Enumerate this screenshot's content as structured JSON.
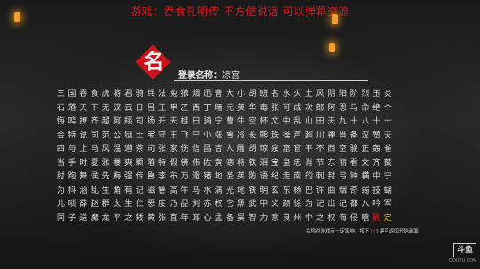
{
  "stream_banner": "游戏：吞食孔明传   不方便说话 可以弹幕交流",
  "seal_char": "名",
  "name_entry": {
    "label": "登录名称：",
    "value": "凉宫"
  },
  "char_grid": [
    [
      "三",
      "国",
      "吞",
      "食",
      "虎",
      "将",
      "君",
      "骑",
      "兵",
      "法",
      "兔",
      "狼",
      "烟",
      "迅",
      "曹",
      "大",
      "小",
      "胡",
      "班",
      "名",
      "水",
      "火",
      "土",
      "风",
      "阴",
      "阳",
      "阶",
      "烈",
      "玉",
      "炎"
    ],
    [
      "石",
      "落",
      "天",
      "下",
      "无",
      "双",
      "云",
      "日",
      "吕",
      "王",
      "甲",
      "乙",
      "西",
      "丁",
      "暗",
      "元",
      "美",
      "华",
      "毒",
      "张",
      "可",
      "成",
      "次",
      "郎",
      "阿",
      "恩",
      "马",
      "命",
      "绝",
      "个"
    ],
    [
      "悔",
      "鸣",
      "撩",
      "齐",
      "超",
      "阿",
      "翔",
      "司",
      "扬",
      "开",
      "天",
      "桂",
      "田",
      "骑",
      "宁",
      "曹",
      "牛",
      "空",
      "杯",
      "文",
      "中",
      "乱",
      "山",
      "田",
      "天",
      "九",
      "十",
      "八",
      "十",
      "十"
    ],
    [
      "会",
      "特",
      "说",
      "司",
      "范",
      "公",
      "狱",
      "士",
      "宝",
      "守",
      "王",
      "飞",
      "宁",
      "小",
      "张",
      "鲁",
      "冷",
      "长",
      "熊",
      "珠",
      "操",
      "芦",
      "超",
      "川",
      "神",
      "肖",
      "备",
      "汉",
      "赞",
      "天"
    ],
    [
      "四",
      "与",
      "上",
      "马",
      "凤",
      "温",
      "道",
      "茶",
      "司",
      "张",
      "家",
      "伤",
      "信",
      "昌",
      "吉",
      "人",
      "雕",
      "胡",
      "琼",
      "泉",
      "窟",
      "官",
      "平",
      "不",
      "西",
      "空",
      "骏",
      "正",
      "轰",
      "雀"
    ],
    [
      "当",
      "手",
      "时",
      "夏",
      "雅",
      "楼",
      "爽",
      "颗",
      "落",
      "特",
      "假",
      "佛",
      "伟",
      "佐",
      "黄",
      "德",
      "将",
      "铁",
      "泪",
      "宝",
      "皇",
      "忠",
      "肖",
      "节",
      "东",
      "丽",
      "看",
      "文",
      "齐",
      "鼓"
    ],
    [
      "肘",
      "跑",
      "舞",
      "侯",
      "先",
      "梅",
      "强",
      "传",
      "鲁",
      "李",
      "布",
      "万",
      "遗",
      "猪",
      "地",
      "圣",
      "英",
      "防",
      "语",
      "纪",
      "走",
      "南",
      "的",
      "刺",
      "封",
      "弓",
      "钟",
      "横",
      "中",
      "宁"
    ],
    [
      "为",
      "抖",
      "涵",
      "乱",
      "生",
      "角",
      "有",
      "记",
      "磁",
      "鲁",
      "高",
      "牛",
      "马",
      "水",
      "满",
      "光",
      "地",
      "铁",
      "明",
      "玄",
      "东",
      "杨",
      "巴",
      "许",
      "曲",
      "烟",
      "奇",
      "弱",
      "技",
      "蝴"
    ],
    [
      "儿",
      "唢",
      "薛",
      "赵",
      "群",
      "太",
      "生",
      "仁",
      "恶",
      "度",
      "乃",
      "品",
      "刘",
      "赤",
      "权",
      "它",
      "黑",
      "武",
      "甲",
      "义",
      "颜",
      "徐",
      "为",
      "记",
      "出",
      "记",
      "都",
      "入",
      "吟",
      "军"
    ],
    [
      "同",
      "子",
      "送",
      "魔",
      "龙",
      "平",
      "之",
      "矮",
      "黄",
      "张",
      "直",
      "年",
      "耳",
      "心",
      "孟",
      "备",
      "吴",
      "智",
      "力",
      "意",
      "良",
      "州",
      "中",
      "之",
      "权",
      "海",
      "侵",
      "嘻",
      "删",
      "定"
    ]
  ],
  "hint": {
    "before": "名称对游戏有一定影响。按下",
    "key": "Y",
    "after": "键可返回开始画面"
  },
  "watermark": {
    "logo": "斗鱼",
    "site": "DOUYU.COM"
  },
  "colors": {
    "seal_red": "#c8141a",
    "banner_red": "#e0141a",
    "confirm_yellow": "#e8c020",
    "delete_red": "#e02020"
  }
}
